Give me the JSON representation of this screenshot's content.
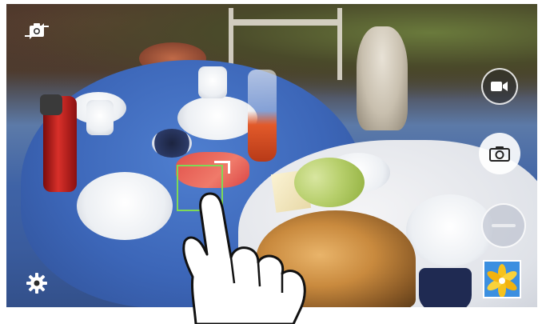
{
  "app": {
    "name": "Camera"
  },
  "controls": {
    "switch_camera": {
      "icon": "switch-camera-icon"
    },
    "settings": {
      "icon": "gear-icon"
    },
    "record_video": {
      "icon": "video-camera-icon"
    },
    "take_photo": {
      "icon": "camera-icon"
    },
    "camera_mode": {
      "icon": "mode-selector-icon"
    },
    "gallery": {
      "icon": "gallery-thumbnail-icon"
    }
  },
  "focus": {
    "color": "#7ed957"
  },
  "gesture": {
    "icon": "tap-hand-icon"
  }
}
